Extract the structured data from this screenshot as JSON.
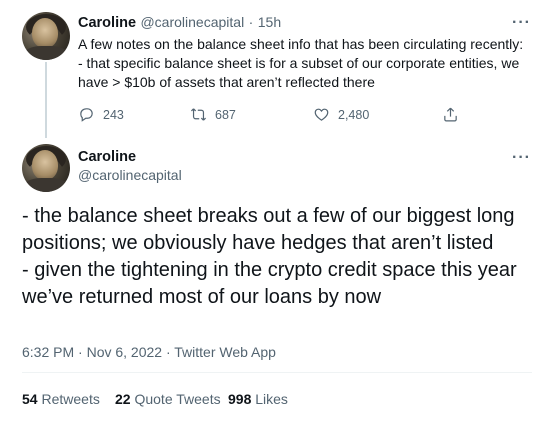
{
  "tweet1": {
    "display_name": "Caroline",
    "handle": "@carolinecapital",
    "separator": "·",
    "time": "15h",
    "more": "···",
    "text": "A few notes on the balance sheet info that has been circulating recently:\n- that specific balance sheet is for a subset of our corporate entities, we have > $10b of assets that aren’t reflected there",
    "replies": "243",
    "retweets": "687",
    "likes": "2,480",
    "icons": [
      "reply-icon",
      "retweet-icon",
      "like-icon",
      "share-icon"
    ]
  },
  "tweet2": {
    "display_name": "Caroline",
    "handle": "@carolinecapital",
    "more": "···",
    "text": "- the balance sheet breaks out a few of our biggest long positions; we obviously have hedges that aren’t listed\n- given the tightening in the crypto credit space this year we’ve returned most of our loans by now",
    "timestamp": "6:32 PM · Nov 6, 2022 · Twitter Web App",
    "stats": {
      "retweets_count": "54",
      "retweets_label": "Retweets",
      "quotes_count": "22",
      "quotes_label": "Quote Tweets",
      "likes_count": "998",
      "likes_label": "Likes"
    }
  },
  "colors": {
    "text": "#0f1419",
    "muted": "#536471",
    "divider": "#eff3f4",
    "thread_line": "#cfd9de"
  }
}
